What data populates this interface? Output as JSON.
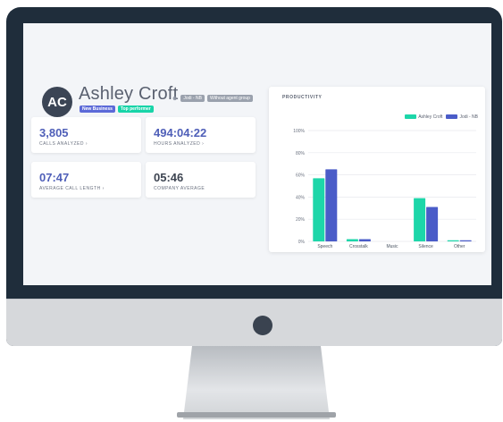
{
  "profile": {
    "initials": "AC",
    "name": "Ashley Croft",
    "badges": [
      "New Business",
      "Top performer"
    ],
    "team_tags": [
      "Jodi - NB",
      "Without agent group"
    ]
  },
  "stats": [
    {
      "value": "3,805",
      "label": "CALLS ANALYZED ›"
    },
    {
      "value": "494:04:22",
      "label": "HOURS ANALYZED ›"
    },
    {
      "value": "07:47",
      "label": "AVERAGE CALL LENGTH ›"
    },
    {
      "value": "05:46",
      "label": "COMPANY AVERAGE"
    }
  ],
  "productivity": {
    "title": "PRODUCTIVITY",
    "legend": [
      "Ashley Croft",
      "Jodi - NB"
    ]
  },
  "chart_data": {
    "type": "bar",
    "categories": [
      "Speech",
      "Crosstalk",
      "Music",
      "Silence",
      "Other"
    ],
    "series": [
      {
        "name": "Ashley Croft",
        "values": [
          57,
          2,
          0,
          39,
          1
        ],
        "color": "#1dd6a9"
      },
      {
        "name": "Jodi - NB",
        "values": [
          65,
          2,
          0,
          31,
          1
        ],
        "color": "#4a5cc8"
      }
    ],
    "ylim": [
      0,
      100
    ],
    "yticks": [
      "0%",
      "20%",
      "40%",
      "60%",
      "80%",
      "100%"
    ],
    "grid": true,
    "legend_position": "top-right"
  }
}
